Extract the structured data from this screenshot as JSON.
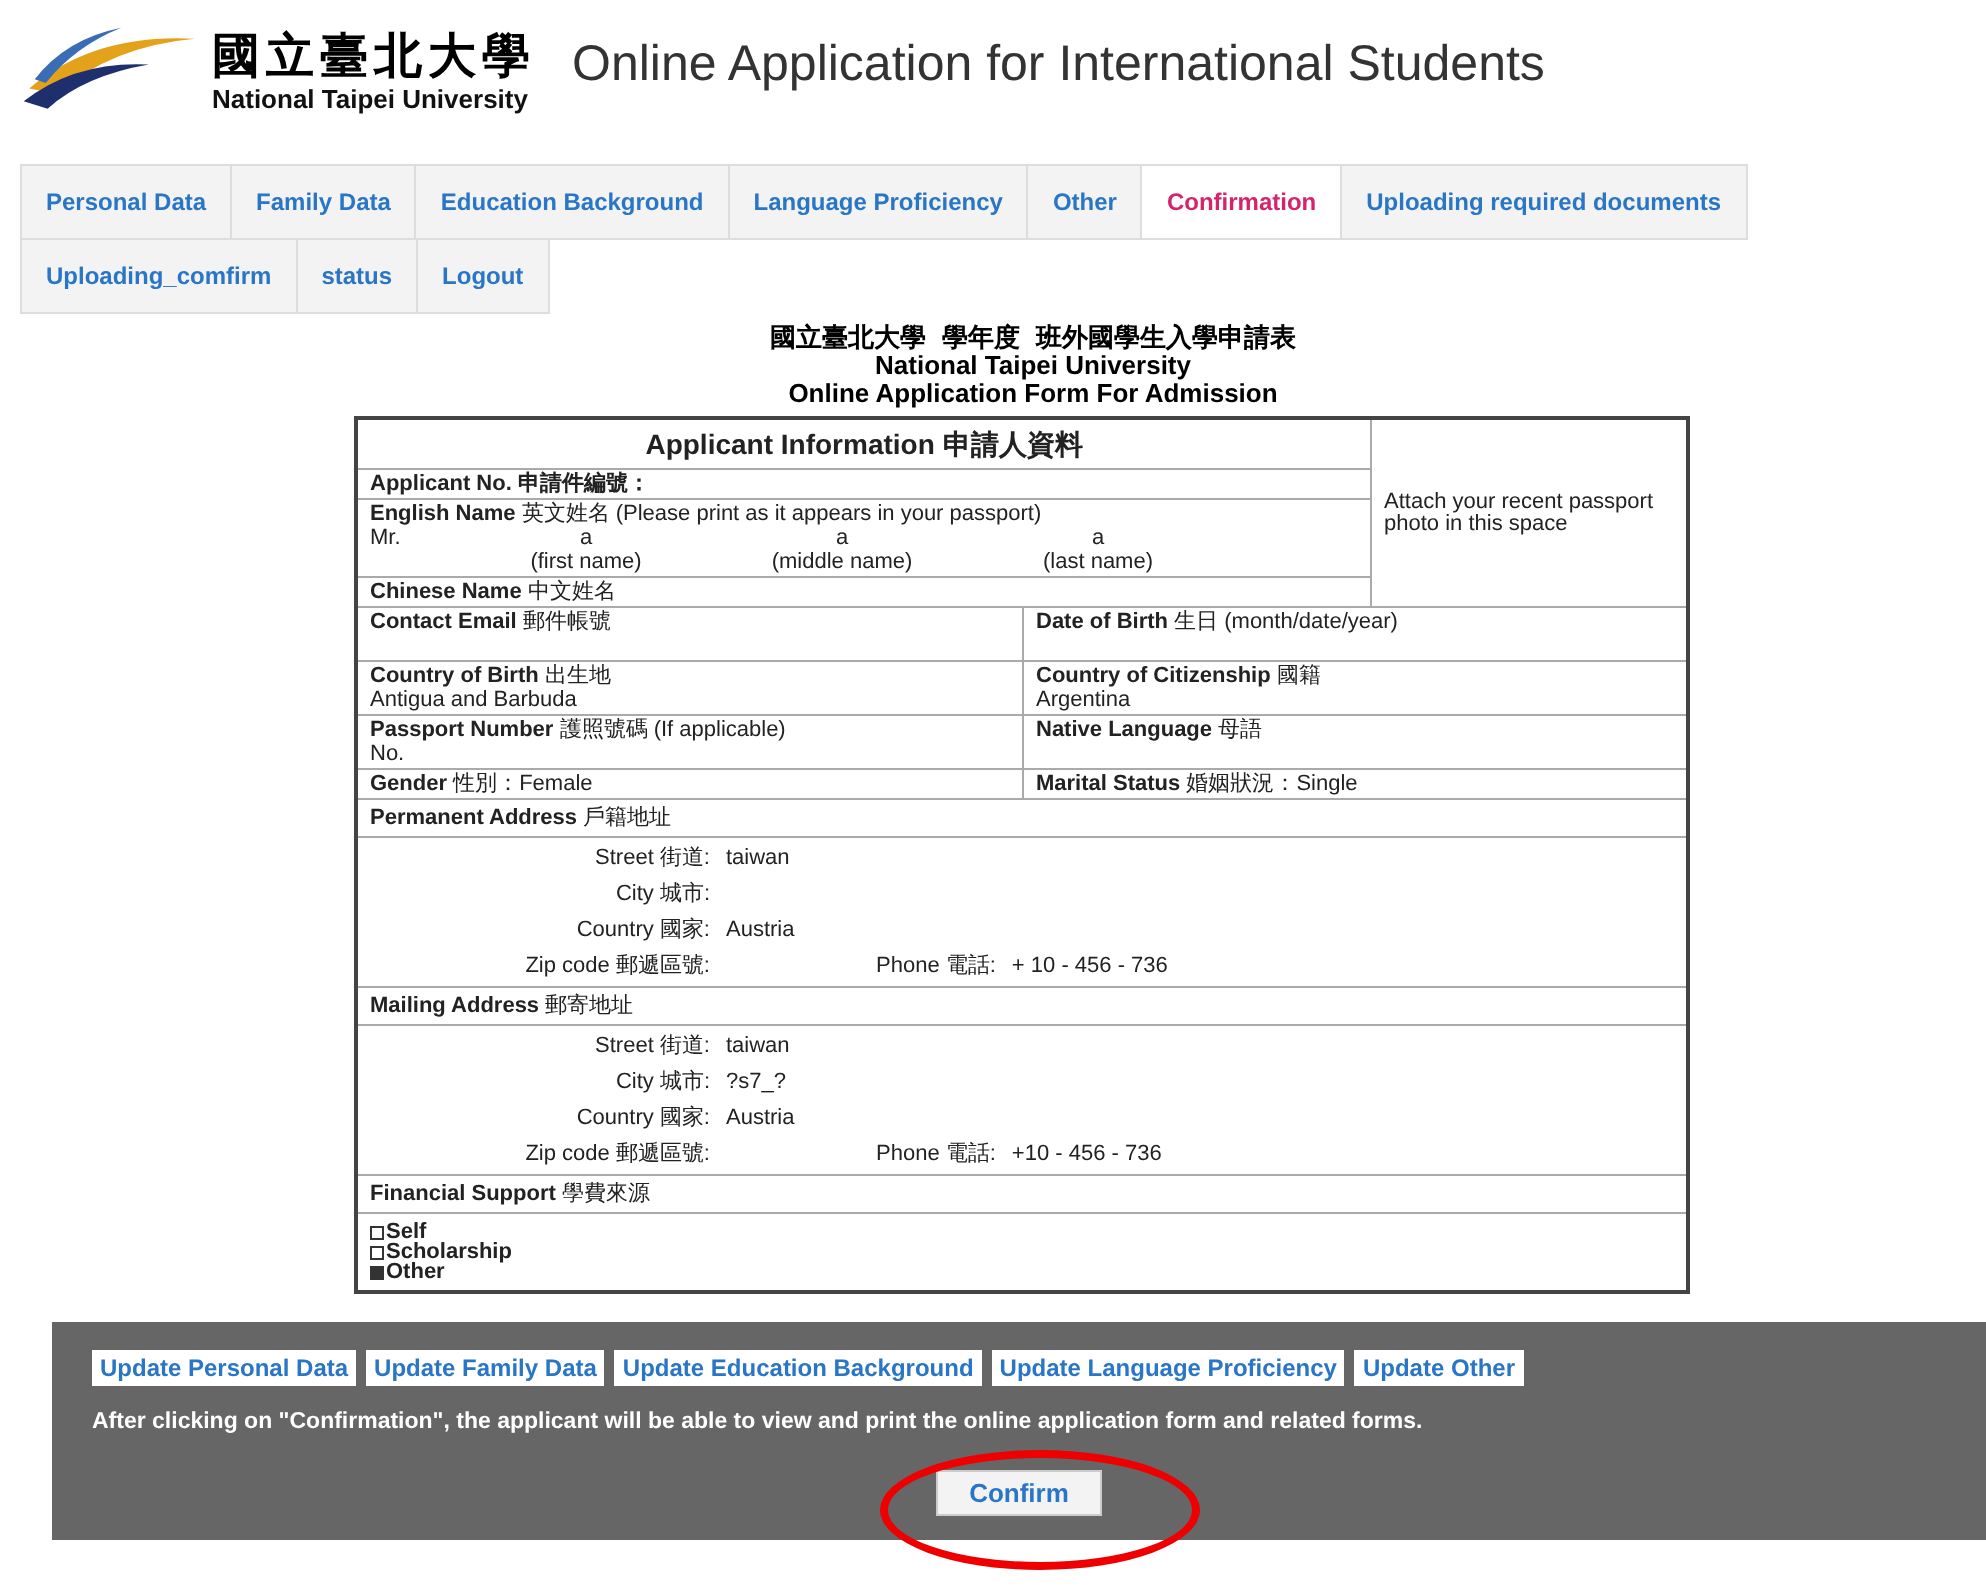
{
  "header": {
    "logo_chinese": "國立臺北大學",
    "logo_english": "National Taipei University",
    "title": "Online Application for International Students"
  },
  "tabs": [
    {
      "label": "Personal Data",
      "selected": false
    },
    {
      "label": "Family Data",
      "selected": false
    },
    {
      "label": "Education Background",
      "selected": false
    },
    {
      "label": "Language Proficiency",
      "selected": false
    },
    {
      "label": "Other",
      "selected": false
    },
    {
      "label": "Confirmation",
      "selected": true
    },
    {
      "label": "Uploading required documents",
      "selected": false
    },
    {
      "label": "Uploading_comfirm",
      "selected": false
    },
    {
      "label": "status",
      "selected": false
    },
    {
      "label": "Logout",
      "selected": false
    }
  ],
  "form_title": {
    "chinese_parts": [
      "國立臺北大學",
      "學年度",
      "班外國學生入學申請表"
    ],
    "english_lines": [
      "National Taipei University",
      "Online Application Form For Admission"
    ]
  },
  "applicant": {
    "heading": "Applicant Information 申請人資料",
    "photo_note": "Attach your recent passport photo in this space",
    "applicant_no_label": "Applicant No. 申請件編號：",
    "english_name_label": "English Name",
    "english_name_cn": "英文姓名",
    "english_name_hint": "(Please print as it appears in your passport)",
    "title": "Mr.",
    "names": [
      {
        "value": "a",
        "caption": "(first name)"
      },
      {
        "value": "a",
        "caption": "(middle name)"
      },
      {
        "value": "a",
        "caption": "(last name)"
      }
    ],
    "chinese_name_label": "Chinese Name",
    "chinese_name_cn": "中文姓名",
    "pairs": [
      [
        {
          "label": "Contact Email",
          "cn": "郵件帳號"
        },
        {
          "label": "Date of Birth",
          "cn": "生日 (month/date/year)"
        }
      ],
      [
        {
          "label": "Country of Birth",
          "cn": "出生地",
          "value": "Antigua and Barbuda"
        },
        {
          "label": "Country of Citizenship",
          "cn": "國籍",
          "value": "Argentina"
        }
      ],
      [
        {
          "label": "Passport Number",
          "cn": "護照號碼 (If applicable)",
          "value": "No."
        },
        {
          "label": "Native Language",
          "cn": "母語"
        }
      ]
    ],
    "gender_label": "Gender",
    "gender_cn": "性別：Female",
    "marital_label": "Marital Status",
    "marital_cn": "婚姻狀況：Single"
  },
  "addresses": [
    {
      "label": "Permanent Address",
      "cn": "戶籍地址",
      "street_label": "Street 街道:",
      "street": "taiwan",
      "city_label": "City 城市:",
      "country_label": "Country 國家:",
      "country": "Austria",
      "zip_label": "Zip code 郵遞區號:",
      "phone_label": "Phone 電話:",
      "phone": "+ 10 - 456 - 736"
    },
    {
      "label": "Mailing Address",
      "cn": "郵寄地址",
      "street_label": "Street 街道:",
      "street": "taiwan",
      "city_label": "City 城市:",
      "city": "?s7_?",
      "country_label": "Country 國家:",
      "country": "Austria",
      "zip_label": "Zip code 郵遞區號:",
      "phone_label": "Phone 電話:",
      "phone": "+10 - 456 - 736"
    }
  ],
  "financial": {
    "label": "Financial Support",
    "cn": "學費來源",
    "options": [
      {
        "label": "Self",
        "checked": false
      },
      {
        "label": "Scholarship",
        "checked": false
      },
      {
        "label": "Other",
        "checked": true
      }
    ]
  },
  "footer": {
    "update_links": [
      "Update Personal Data",
      "Update Family Data",
      "Update Education Background",
      "Update Language Proficiency",
      "Update Other"
    ],
    "note": "After clicking on \"Confirmation\", the applicant will be able to view and print the online application form and related forms.",
    "confirm": "Confirm"
  }
}
